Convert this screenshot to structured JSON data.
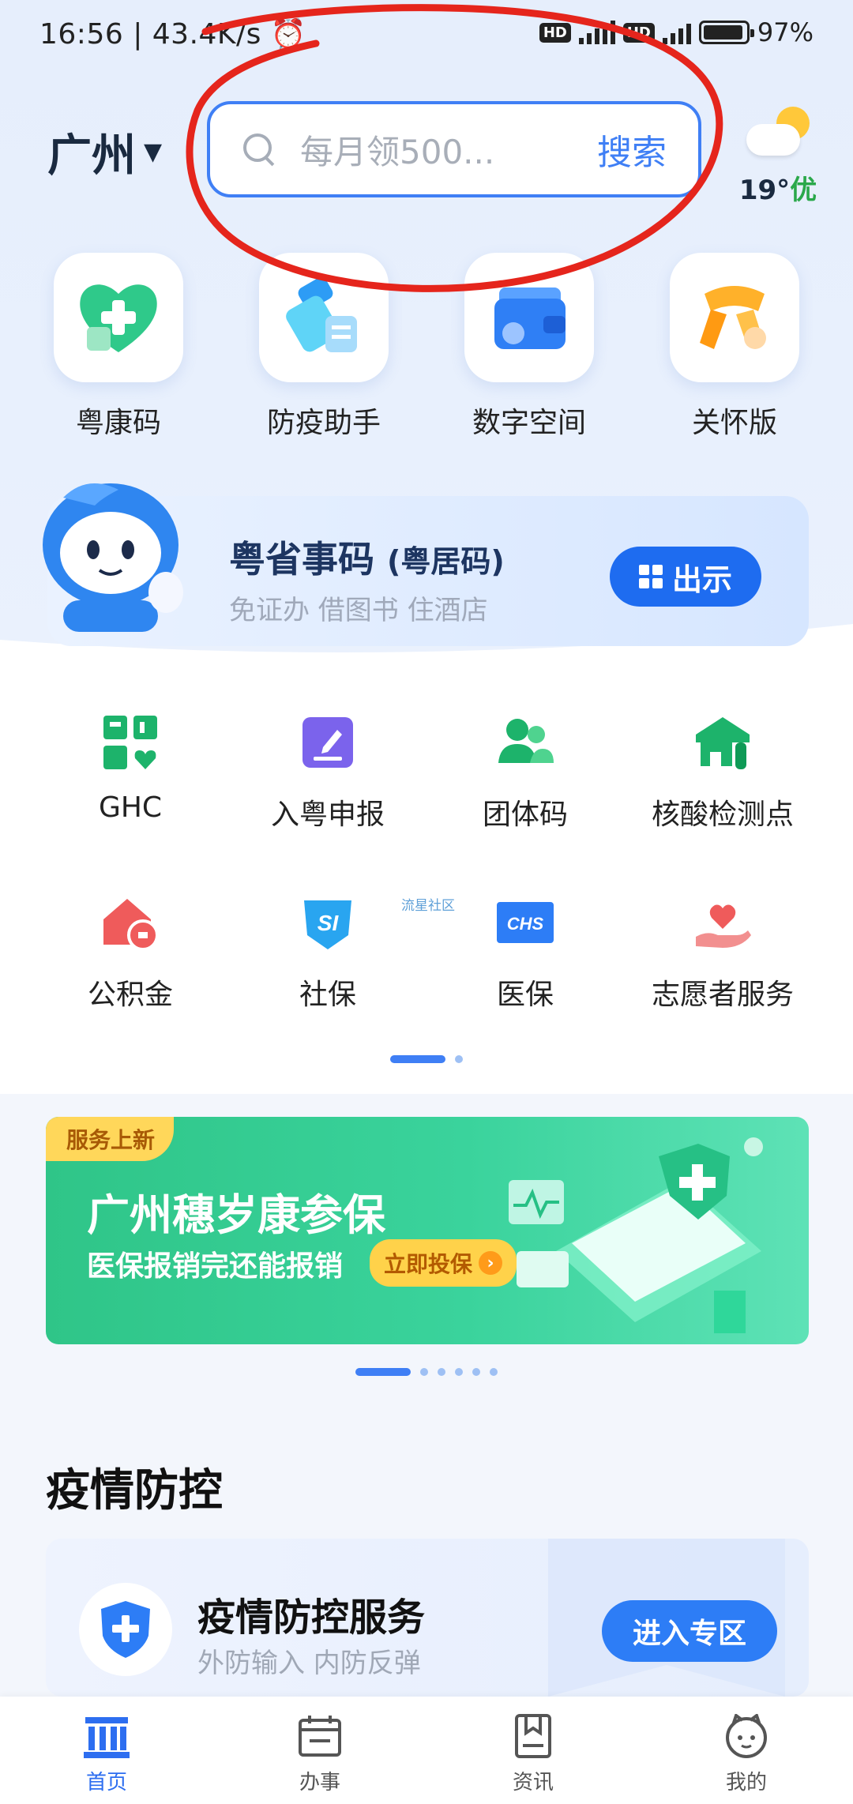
{
  "status_bar": {
    "time_speed": "16:56 | 43.4K/s",
    "hd1": "HD",
    "net": "4G",
    "hd2": "HD",
    "battery": "97%"
  },
  "header": {
    "city": "广州",
    "search_placeholder": "每月领500...",
    "search_button": "搜索",
    "weather_temp": "19°",
    "weather_quality": "优"
  },
  "quick_access": [
    {
      "label": "粤康码",
      "icon": "heart-plus-icon",
      "color": "#2fc98a"
    },
    {
      "label": "防疫助手",
      "icon": "medicine-icon",
      "color": "#3ec2f5"
    },
    {
      "label": "数字空间",
      "icon": "wallet-icon",
      "color": "#2f7ff5"
    },
    {
      "label": "关怀版",
      "icon": "scarf-icon",
      "color": "#ffa21f"
    }
  ],
  "code_card": {
    "title": "粤省事码",
    "title_sub": "(粤居码)",
    "subtitle": "免证办 借图书 住酒店",
    "show_button": "出示"
  },
  "services": [
    {
      "label": "GHC",
      "icon": "ghc-icon"
    },
    {
      "label": "入粤申报",
      "icon": "declare-icon"
    },
    {
      "label": "团体码",
      "icon": "group-icon"
    },
    {
      "label": "核酸检测点",
      "icon": "test-site-icon"
    },
    {
      "label": "公积金",
      "icon": "housing-fund-icon"
    },
    {
      "label": "社保",
      "icon": "social-security-icon"
    },
    {
      "label": "医保",
      "icon": "medical-insurance-icon"
    },
    {
      "label": "志愿者服务",
      "icon": "volunteer-icon"
    }
  ],
  "watermark": "流星社区",
  "banner": {
    "tag": "服务上新",
    "title": "广州穗岁康参保",
    "subtitle": "医保报销完还能报销",
    "button": "立即投保"
  },
  "section": {
    "title": "疫情防控"
  },
  "epidemic_card": {
    "title": "疫情防控服务",
    "subtitle": "外防输入 内防反弹",
    "button": "进入专区"
  },
  "bottom_nav": [
    {
      "label": "首页",
      "active": true
    },
    {
      "label": "办事",
      "active": false
    },
    {
      "label": "资讯",
      "active": false
    },
    {
      "label": "我的",
      "active": false
    }
  ],
  "colors": {
    "accent": "#3f7ff5",
    "annotation_red": "#e5251c",
    "banner_green": "#2fc588"
  }
}
